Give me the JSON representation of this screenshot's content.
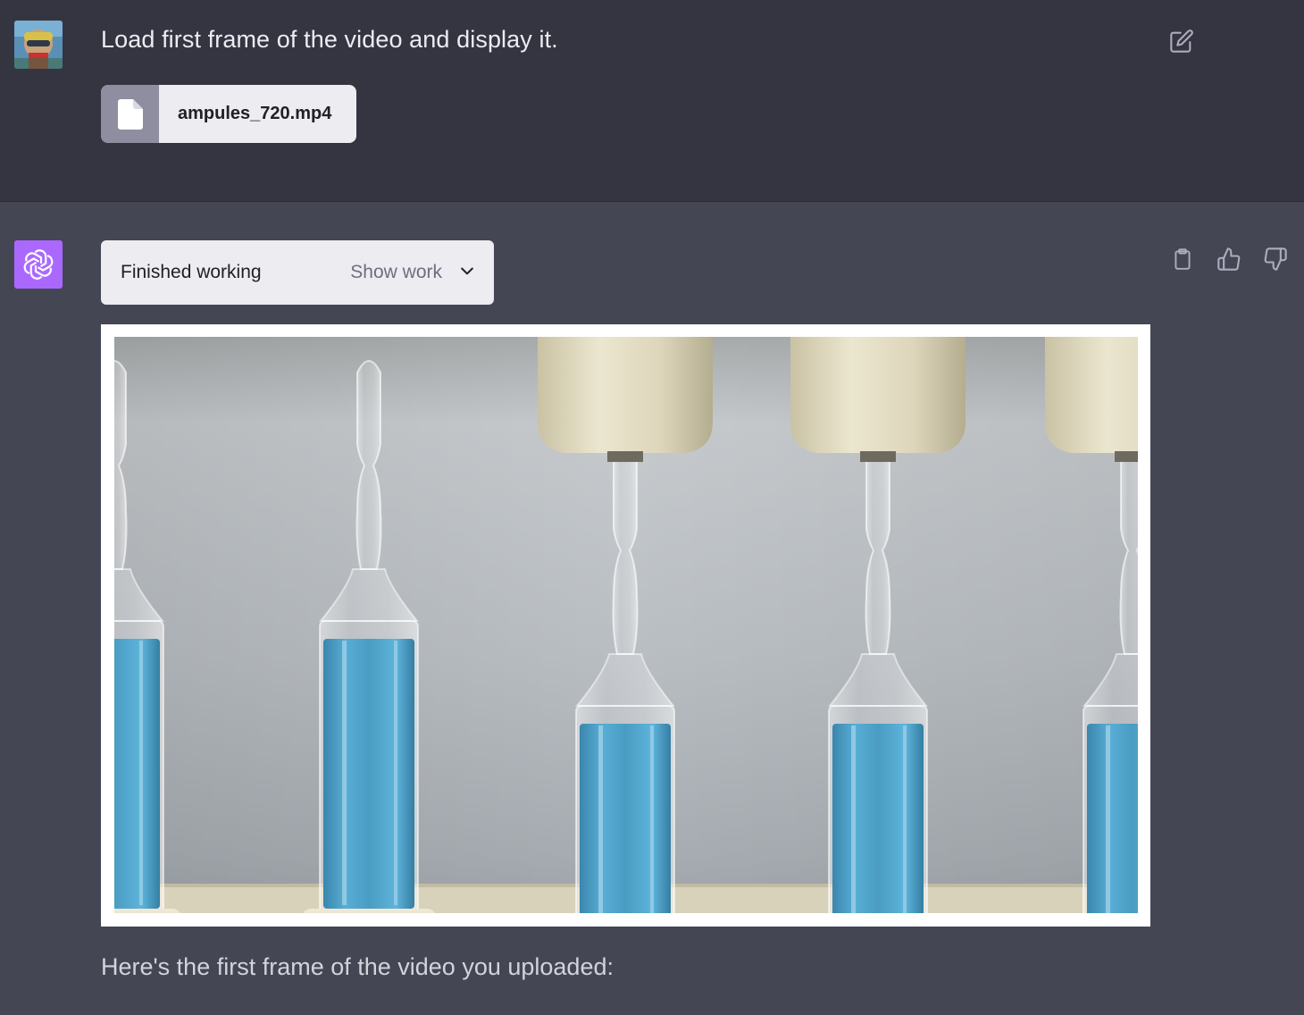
{
  "user_message": {
    "text": "Load first frame of the video and display it.",
    "attachment": {
      "filename": "ampules_720.mp4",
      "icon": "file-icon"
    },
    "avatar_icon": "user-avatar",
    "edit_icon": "edit-icon"
  },
  "assistant_message": {
    "avatar_icon": "openai-logo-icon",
    "work_status": "Finished working",
    "show_work_label": "Show work",
    "show_work_icon": "chevron-down-icon",
    "actions": [
      "clipboard-icon",
      "thumbs-up-icon",
      "thumbs-down-icon"
    ],
    "image_subject": "video-frame-ampules",
    "text": "Here's the first frame of the video you uploaded:"
  },
  "colors": {
    "user_bg": "#343541",
    "assistant_bg": "#444654",
    "bot_avatar": "#ab68ff",
    "liquid": "#4a9cc2"
  }
}
